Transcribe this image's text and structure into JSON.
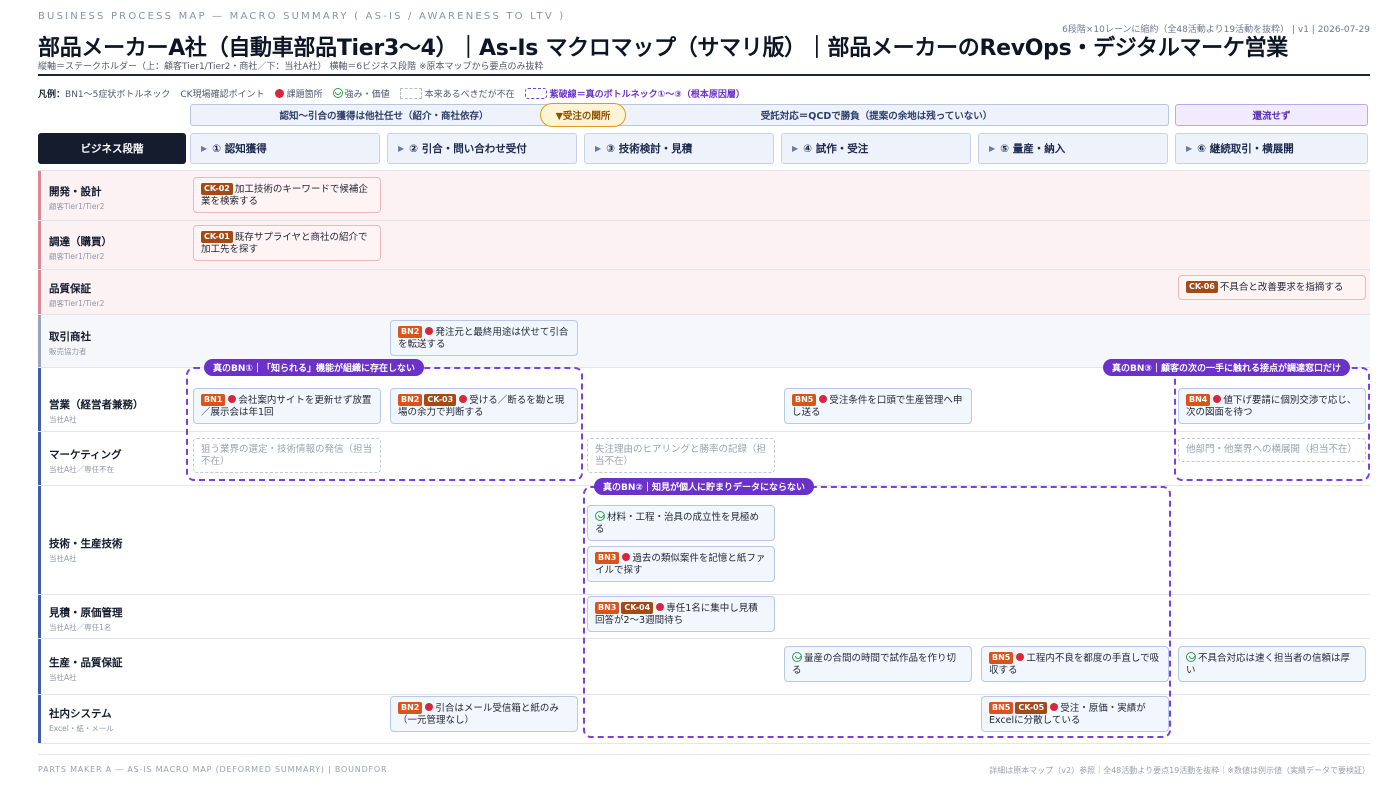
{
  "header": {
    "eyebrow": "BUSINESS PROCESS MAP — MACRO SUMMARY ( AS-IS / AWARENESS TO LTV )",
    "meta": "6段階×10レーンに縮約（全48活動より19活動を抜粋） | v1 | 2026-07-29",
    "title": "部品メーカーA社（自動車部品Tier3〜4）｜As-Is マクロマップ（サマリ版）｜部品メーカーのRevOps・デジタルマーケ営業",
    "subtitle": "縦軸＝ステークホルダー（上：顧客Tier1/Tier2・商社／下：当社A社） 横軸＝6ビジネス段階 ※原本マップから要点のみ抜粋"
  },
  "legend": {
    "label": "凡例：",
    "bn": "BN1〜5症状ボトルネック",
    "ck": "CK現場確認ポイント",
    "issue": "課題箇所",
    "strength": "強み・価値",
    "absent": "本来あるべきだが不在",
    "true_bn": "紫破線＝真のボトルネック①〜③（根本原因層）"
  },
  "bands": {
    "acquisition": "認知〜引合の獲得は他社任せ（紹介・商社依存）",
    "marker": "▼受注の関所",
    "order": "受託対応＝QCDで勝負（提案の余地は残っていない）",
    "no_return": "還流せず"
  },
  "stages": {
    "title": "ビジネス段階",
    "items": [
      {
        "label": "① 認知獲得"
      },
      {
        "label": "② 引合・問い合わせ受付"
      },
      {
        "label": "③ 技術検討・見積"
      },
      {
        "label": "④ 試作・受注"
      },
      {
        "label": "⑤ 量産・納入"
      },
      {
        "label": "⑥ 継続取引・横展開"
      }
    ]
  },
  "lanes": [
    {
      "name": "開発・設計",
      "sub": "顧客Tier1/Tier2"
    },
    {
      "name": "調達（購買）",
      "sub": "顧客Tier1/Tier2"
    },
    {
      "name": "品質保証",
      "sub": "顧客Tier1/Tier2"
    },
    {
      "name": "取引商社",
      "sub": "販売協力者"
    },
    {
      "name": "営業（経営者兼務）",
      "sub": "当社A社"
    },
    {
      "name": "マーケティング",
      "sub": "当社A社／専任不在"
    },
    {
      "name": "技術・生産技術",
      "sub": "当社A社"
    },
    {
      "name": "見積・原価管理",
      "sub": "当社A社／専任1名"
    },
    {
      "name": "生産・品質保証",
      "sub": "当社A社"
    },
    {
      "name": "社内システム",
      "sub": "Excel・紙・メール"
    }
  ],
  "bottlenecks": {
    "bn1": "真のBN①｜「知られる」機能が組織に存在しない",
    "bn2": "真のBN②｜知見が個人に貯まりデータにならない",
    "bn3": "真のBN③｜顧客の次の一手に触れる接点が調達窓口だけ"
  },
  "cards": {
    "c1": {
      "tags": [
        "CK-02"
      ],
      "text": "加工技術のキーワードで候補企業を検索する"
    },
    "c2": {
      "tags": [
        "CK-01"
      ],
      "text": "既存サプライヤと商社の紹介で加工先を探す"
    },
    "c3": {
      "tags": [
        "CK-06"
      ],
      "text": "不具合と改善要求を指摘する"
    },
    "c4": {
      "tags": [
        "BN2"
      ],
      "text": "発注元と最終用途は伏せて引合を転送する"
    },
    "c5": {
      "tags": [
        "BN1"
      ],
      "text": "会社案内サイトを更新せず放置／展示会は年1回"
    },
    "c6": {
      "tags": [
        "BN2",
        "CK-03"
      ],
      "text": "受ける／断るを勘と現場の余力で判断する"
    },
    "c7": {
      "tags": [
        "BN5"
      ],
      "text": "受注条件を口頭で生産管理へ申し送る"
    },
    "c8": {
      "tags": [
        "BN4"
      ],
      "text": "値下げ要請に個別交渉で応じ、次の図面を待つ"
    },
    "c9": {
      "text": "狙う業界の選定・技術情報の発信（担当不在）"
    },
    "c10": {
      "text": "失注理由のヒアリングと勝率の記録（担当不在）"
    },
    "c11": {
      "text": "他部門・他業界への横展開（担当不在）"
    },
    "c12": {
      "text": "材料・工程・治具の成立性を見極める"
    },
    "c13": {
      "tags": [
        "BN3"
      ],
      "text": "過去の類似案件を記憶と紙ファイルで探す"
    },
    "c14": {
      "tags": [
        "BN3",
        "CK-04"
      ],
      "text": "専任1名に集中し見積回答が2〜3週間待ち"
    },
    "c15": {
      "text": "量産の合間の時間で試作品を作り切る"
    },
    "c16": {
      "tags": [
        "BN5"
      ],
      "text": "工程内不良を都度の手直しで吸収する"
    },
    "c17": {
      "text": "不具合対応は速く担当者の信頼は厚い"
    },
    "c18": {
      "tags": [
        "BN2"
      ],
      "text": "引合はメール受信箱と紙のみ（一元管理なし）"
    },
    "c19": {
      "tags": [
        "BN5",
        "CK-05"
      ],
      "text": "受注・原価・実績がExcelに分散している"
    }
  },
  "footer": {
    "left": "PARTS MAKER A — AS-IS MACRO MAP (DEFORMED SUMMARY) | BOUNDFOR",
    "right": "詳細は原本マップ（v2）参照｜全48活動より要点19活動を抜粋｜※数値は例示値（実績データで要検証）"
  },
  "colors": {
    "ink": "#141c2e",
    "bn_purple": "#7b3fe4",
    "bn_tag": "#d9541c",
    "ck_tag": "#a44a16",
    "issue_red": "#d7263d",
    "strength_green": "#2e9e4f",
    "customer_lane": "#d98a96",
    "company_lane": "#3f5fae"
  }
}
